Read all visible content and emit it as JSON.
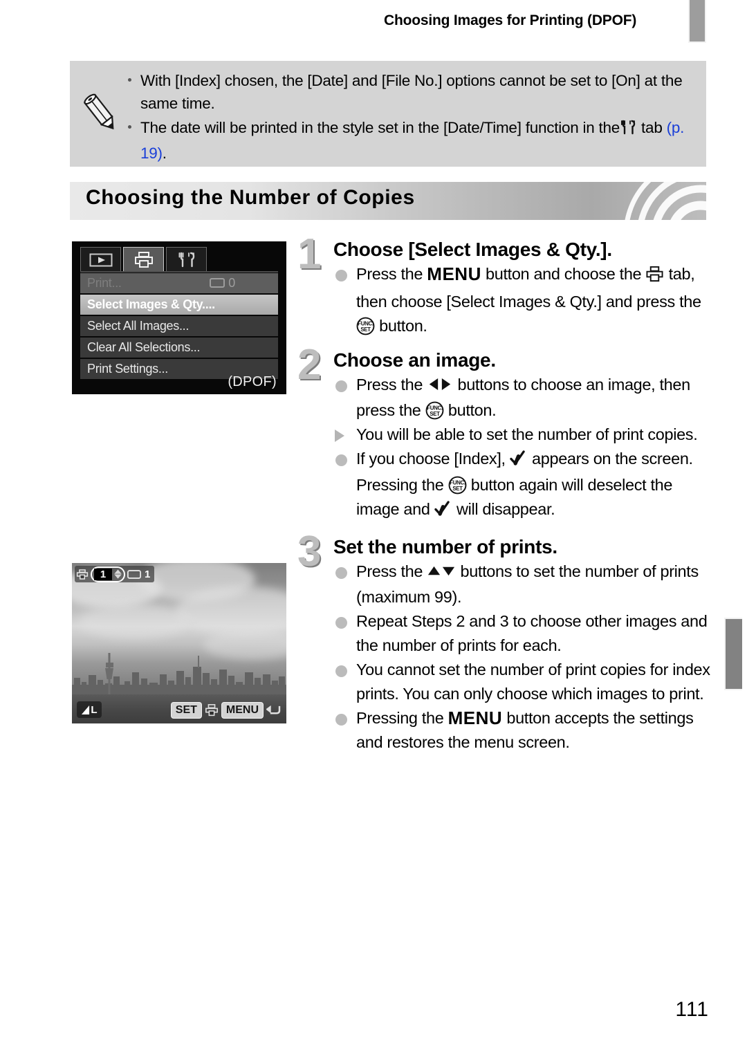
{
  "header": {
    "title": "Choosing Images for Printing (DPOF)"
  },
  "note": {
    "icon": "pencil-icon",
    "items": [
      "With [Index] chosen, the [Date] and [File No.] options cannot be set to [On] at the same time.",
      "The date will be printed in the style set in the [Date/Time] function in the"
    ],
    "item2_tail": " tab ",
    "item2_link": "(p. 19)",
    "item2_end": "."
  },
  "section": {
    "heading": "Choosing the Number of Copies"
  },
  "camera_menu": {
    "tabs": [
      {
        "name": "playback-tab",
        "icon": "play-icon",
        "active": false
      },
      {
        "name": "print-tab",
        "icon": "printer-icon",
        "active": true
      },
      {
        "name": "settings-tab",
        "icon": "tools-icon",
        "active": false
      }
    ],
    "rows": [
      {
        "label": "Print...",
        "value": "0",
        "state": "disabled"
      },
      {
        "label": "Select Images & Qty....",
        "value": "",
        "state": "selected"
      },
      {
        "label": "Select All Images...",
        "value": "",
        "state": "normal"
      },
      {
        "label": "Clear All Selections...",
        "value": "",
        "state": "normal"
      },
      {
        "label": "Print Settings...",
        "value": "",
        "state": "normal"
      }
    ],
    "dpof_label": "(DPOF)"
  },
  "camera_photo": {
    "print_qty": "1",
    "index_count": "1",
    "quality_badge": "L",
    "set_key": "SET",
    "menu_key": "MENU",
    "subject": "city skyline with CN Tower, grayscale"
  },
  "steps": [
    {
      "number": "1",
      "title": "Choose [Select Images & Qty.].",
      "bullets": [
        {
          "marker": "dot",
          "parts": [
            {
              "t": "text",
              "v": "Press the "
            },
            {
              "t": "menu",
              "v": "MENU"
            },
            {
              "t": "text",
              "v": " button and choose the "
            },
            {
              "t": "printer",
              "v": "printer-icon"
            },
            {
              "t": "text",
              "v": " tab, then choose [Select Images & Qty.] and press the "
            },
            {
              "t": "func",
              "v": "FUNC/SET"
            },
            {
              "t": "text",
              "v": " button."
            }
          ]
        }
      ]
    },
    {
      "number": "2",
      "title": "Choose an image.",
      "bullets": [
        {
          "marker": "dot",
          "parts": [
            {
              "t": "text",
              "v": "Press the "
            },
            {
              "t": "lr",
              "v": "left-right-arrows"
            },
            {
              "t": "text",
              "v": " buttons to choose an image, then press the "
            },
            {
              "t": "func",
              "v": "FUNC/SET"
            },
            {
              "t": "text",
              "v": " button."
            }
          ]
        },
        {
          "marker": "triangle",
          "parts": [
            {
              "t": "text",
              "v": "You will be able to set the number of print copies."
            }
          ]
        },
        {
          "marker": "dot",
          "parts": [
            {
              "t": "text",
              "v": "If you choose [Index], "
            },
            {
              "t": "check",
              "v": "checkmark"
            },
            {
              "t": "text",
              "v": " appears on the screen. Pressing the "
            },
            {
              "t": "func",
              "v": "FUNC/SET"
            },
            {
              "t": "text",
              "v": " button again will deselect the image and "
            },
            {
              "t": "check",
              "v": "checkmark"
            },
            {
              "t": "text",
              "v": " will disappear."
            }
          ]
        }
      ]
    },
    {
      "number": "3",
      "title": "Set the number of prints.",
      "bullets": [
        {
          "marker": "dot",
          "parts": [
            {
              "t": "text",
              "v": "Press the "
            },
            {
              "t": "ud",
              "v": "up-down-arrows"
            },
            {
              "t": "text",
              "v": " buttons to set the number of prints (maximum 99)."
            }
          ]
        },
        {
          "marker": "dot",
          "parts": [
            {
              "t": "text",
              "v": "Repeat Steps 2 and 3 to choose other images and the number of prints for each."
            }
          ]
        },
        {
          "marker": "dot",
          "parts": [
            {
              "t": "text",
              "v": "You cannot set the number of print copies for index prints. You can only choose which images to print."
            }
          ]
        },
        {
          "marker": "dot",
          "parts": [
            {
              "t": "text",
              "v": "Pressing the "
            },
            {
              "t": "menu",
              "v": "MENU"
            },
            {
              "t": "text",
              "v": " button accepts the settings and restores the menu screen."
            }
          ]
        }
      ]
    }
  ],
  "footer": {
    "page_number": "111"
  },
  "colors": {
    "note_bg": "#d4d4d4",
    "link": "#1a3fd8",
    "bullet": "#bbbbbb",
    "step_num": "#bdbdbd",
    "tab_marker": "#9d9d9d"
  }
}
